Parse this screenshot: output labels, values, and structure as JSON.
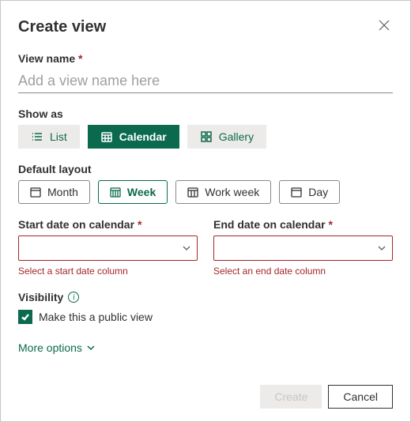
{
  "dialog": {
    "title": "Create view"
  },
  "viewName": {
    "label": "View name",
    "required": "*",
    "placeholder": "Add a view name here"
  },
  "showAs": {
    "label": "Show as",
    "options": [
      "List",
      "Calendar",
      "Gallery"
    ],
    "selected": "Calendar"
  },
  "layout": {
    "label": "Default layout",
    "options": [
      "Month",
      "Week",
      "Work week",
      "Day"
    ],
    "selected": "Week"
  },
  "startDate": {
    "label": "Start date on calendar",
    "required": "*",
    "error": "Select a start date column"
  },
  "endDate": {
    "label": "End date on calendar",
    "required": "*",
    "error": "Select an end date column"
  },
  "visibility": {
    "label": "Visibility",
    "checkboxLabel": "Make this a public view",
    "checked": true
  },
  "moreOptions": "More options",
  "footer": {
    "create": "Create",
    "cancel": "Cancel"
  }
}
